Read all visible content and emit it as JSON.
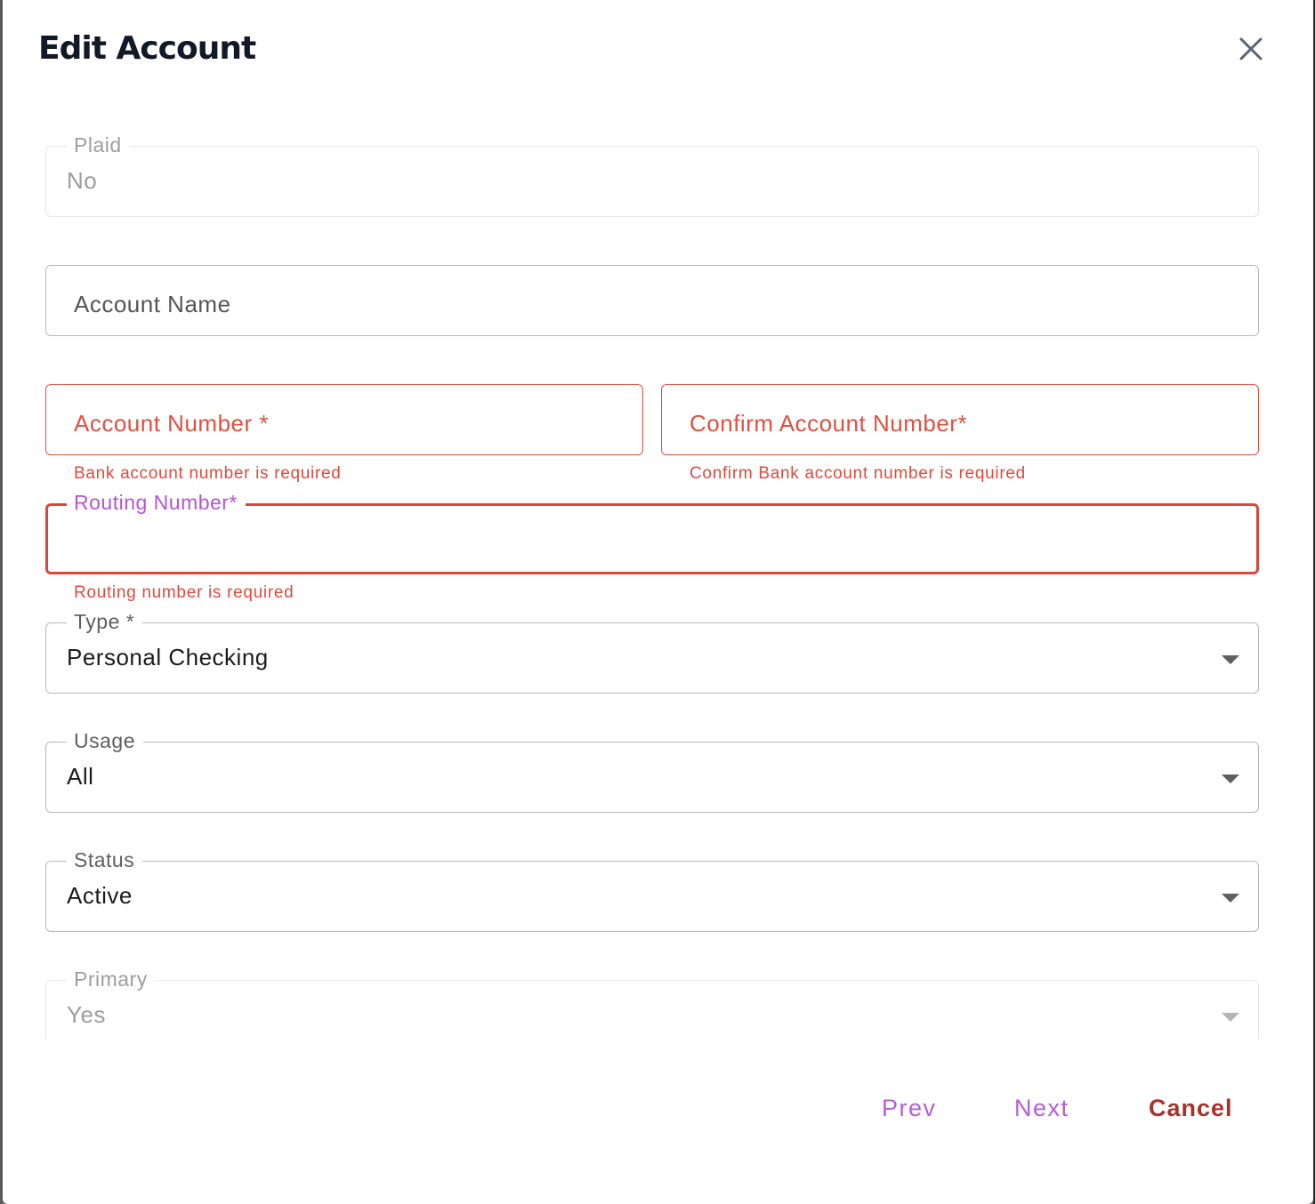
{
  "dialog": {
    "title": "Edit Account",
    "close_icon": "close-icon"
  },
  "fields": {
    "plaid": {
      "label": "Plaid",
      "value": "No",
      "disabled": true
    },
    "account_name": {
      "placeholder": "Account Name",
      "value": ""
    },
    "account_number": {
      "placeholder": "Account Number *",
      "value": "",
      "error": "Bank account number is required"
    },
    "confirm_account_number": {
      "placeholder": "Confirm Account Number*",
      "value": "",
      "error": "Confirm Bank account number is required"
    },
    "routing_number": {
      "label": "Routing Number*",
      "value": "",
      "error": "Routing number is required"
    },
    "type": {
      "label": "Type *",
      "value": "Personal Checking",
      "icon": "chevron-down-icon"
    },
    "usage": {
      "label": "Usage",
      "value": "All",
      "icon": "chevron-down-icon"
    },
    "status": {
      "label": "Status",
      "value": "Active",
      "icon": "chevron-down-icon"
    },
    "primary": {
      "label": "Primary",
      "value": "Yes",
      "disabled": true,
      "icon": "chevron-down-icon"
    }
  },
  "footer": {
    "prev_label": "Prev",
    "next_label": "Next",
    "cancel_label": "Cancel"
  },
  "colors": {
    "accent": "#b65ed6",
    "error": "#e04a3b",
    "cancel": "#a8322a",
    "title": "#111827"
  }
}
